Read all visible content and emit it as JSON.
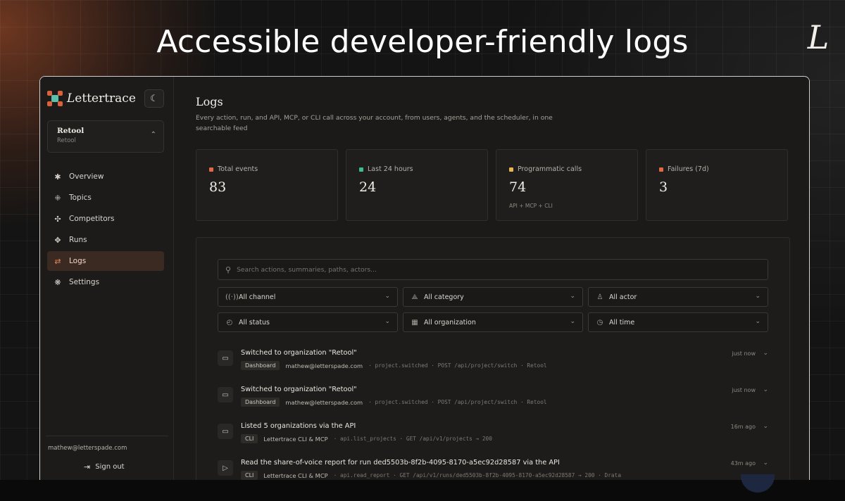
{
  "slide": {
    "headline": "Accessible developer-friendly logs",
    "corner_logo": "L"
  },
  "brand": {
    "name_initial": "L",
    "name_rest": "ettertrace"
  },
  "org": {
    "name": "Retool",
    "sub": "Retool"
  },
  "nav": {
    "items": [
      {
        "label": "Overview",
        "icon": "overview-icon"
      },
      {
        "label": "Topics",
        "icon": "topics-icon"
      },
      {
        "label": "Competitors",
        "icon": "competitors-icon"
      },
      {
        "label": "Runs",
        "icon": "runs-icon"
      },
      {
        "label": "Logs",
        "icon": "logs-icon",
        "active": true
      },
      {
        "label": "Settings",
        "icon": "settings-icon"
      }
    ]
  },
  "user": {
    "email": "mathew@letterspade.com",
    "signout_label": "Sign out"
  },
  "page": {
    "title": "Logs",
    "description": "Every action, run, and API, MCP, or CLI call across your account, from users, agents, and the scheduler, in one searchable feed"
  },
  "stats": [
    {
      "label": "Total events",
      "value": "83",
      "sub": "",
      "color": "#e06a42"
    },
    {
      "label": "Last 24 hours",
      "value": "24",
      "sub": "",
      "color": "#3dbd8b"
    },
    {
      "label": "Programmatic calls",
      "value": "74",
      "sub": "API + MCP + CLI",
      "color": "#e6b450"
    },
    {
      "label": "Failures (7d)",
      "value": "3",
      "sub": "",
      "color": "#e06a42"
    }
  ],
  "search": {
    "placeholder": "Search actions, summaries, paths, actors..."
  },
  "filters": [
    {
      "label": "All channel",
      "icon": "channel-icon"
    },
    {
      "label": "All category",
      "icon": "category-icon"
    },
    {
      "label": "All actor",
      "icon": "actor-icon"
    },
    {
      "label": "All status",
      "icon": "status-icon"
    },
    {
      "label": "All organization",
      "icon": "organization-icon"
    },
    {
      "label": "All time",
      "icon": "clock-icon"
    }
  ],
  "logs": [
    {
      "title": "Switched to organization \"Retool\"",
      "chip": "Dashboard",
      "actor": "mathew@letterspade.com",
      "detail": "· project.switched · POST /api/project/switch · Retool",
      "time": "just now",
      "icon": "folder-icon"
    },
    {
      "title": "Switched to organization \"Retool\"",
      "chip": "Dashboard",
      "actor": "mathew@letterspade.com",
      "detail": "· project.switched · POST /api/project/switch · Retool",
      "time": "just now",
      "icon": "folder-icon"
    },
    {
      "title": "Listed 5 organizations via the API",
      "chip": "CLI",
      "actor": "Lettertrace CLI & MCP",
      "detail": "· api.list_projects · GET /api/v1/projects → 200",
      "time": "16m ago",
      "icon": "folder-icon"
    },
    {
      "title": "Read the share-of-voice report for run ded5503b-8f2b-4095-8170-a5ec92d28587 via the API",
      "chip": "CLI",
      "actor": "Lettertrace CLI & MCP",
      "detail": "· api.read_report · GET /api/v1/runs/ded5503b-8f2b-4095-8170-a5ec92d28587 → 200 · Drata",
      "time": "43m ago",
      "icon": "play-icon"
    }
  ]
}
